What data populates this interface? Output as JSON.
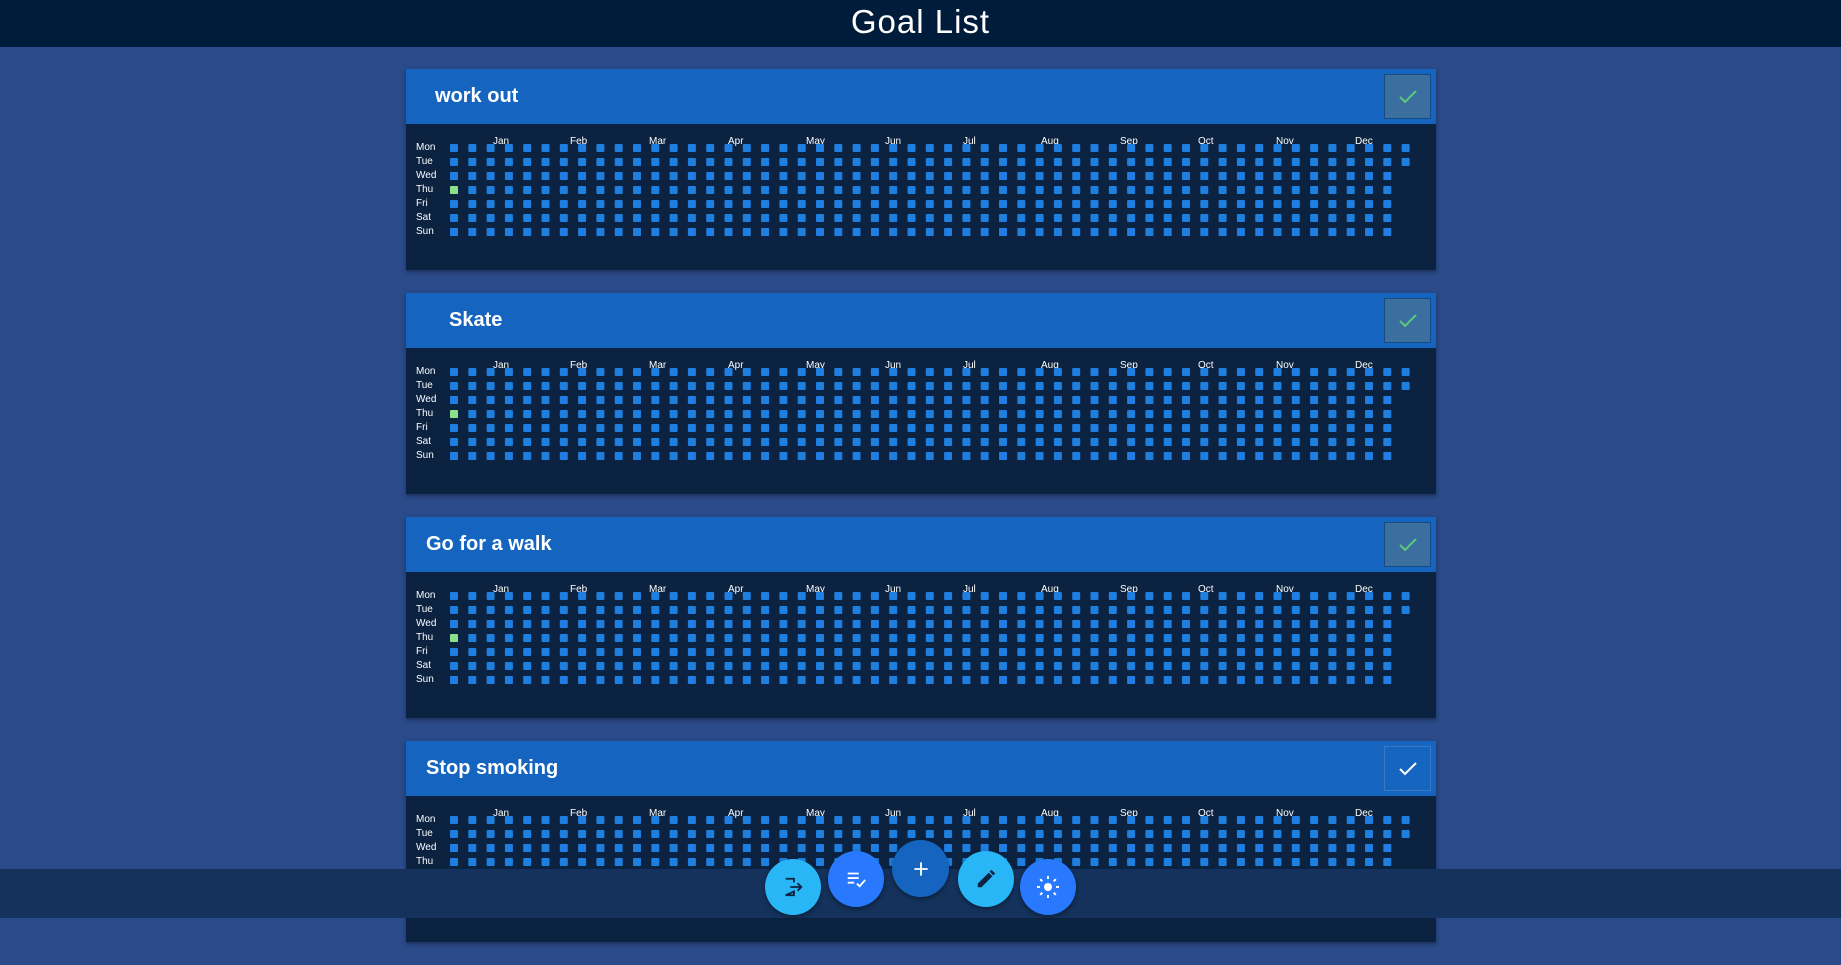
{
  "page": {
    "title": "Goal List"
  },
  "months": [
    "Jan",
    "Feb",
    "Mar",
    "Apr",
    "May",
    "Jun",
    "Jul",
    "Aug",
    "Sep",
    "Oct",
    "Nov",
    "Dec"
  ],
  "days": [
    "Mon",
    "Tue",
    "Wed",
    "Thu",
    "Fri",
    "Sat",
    "Sun"
  ],
  "colors": {
    "cell": "#1e7fe0",
    "done": "#8be08b",
    "check_dim": "#5fc77a",
    "check_bright": "#ffffff"
  },
  "goals": [
    {
      "title": "work out",
      "check_style": "dim",
      "completed_days": [
        {
          "week": 0,
          "day": "Thu"
        }
      ]
    },
    {
      "title": "Skate",
      "check_style": "dim",
      "completed_days": [
        {
          "week": 0,
          "day": "Thu"
        }
      ]
    },
    {
      "title": "Go for a walk",
      "check_style": "dim",
      "completed_days": [
        {
          "week": 0,
          "day": "Thu"
        }
      ]
    },
    {
      "title": "Stop smoking",
      "check_style": "bright",
      "completed_days": []
    }
  ],
  "actions": [
    {
      "name": "logout-button",
      "icon": "logout-icon"
    },
    {
      "name": "checklist-button",
      "icon": "checklist-icon"
    },
    {
      "name": "add-goal-button",
      "icon": "plus-icon"
    },
    {
      "name": "edit-button",
      "icon": "pencil-icon"
    },
    {
      "name": "theme-button",
      "icon": "sun-icon"
    }
  ]
}
